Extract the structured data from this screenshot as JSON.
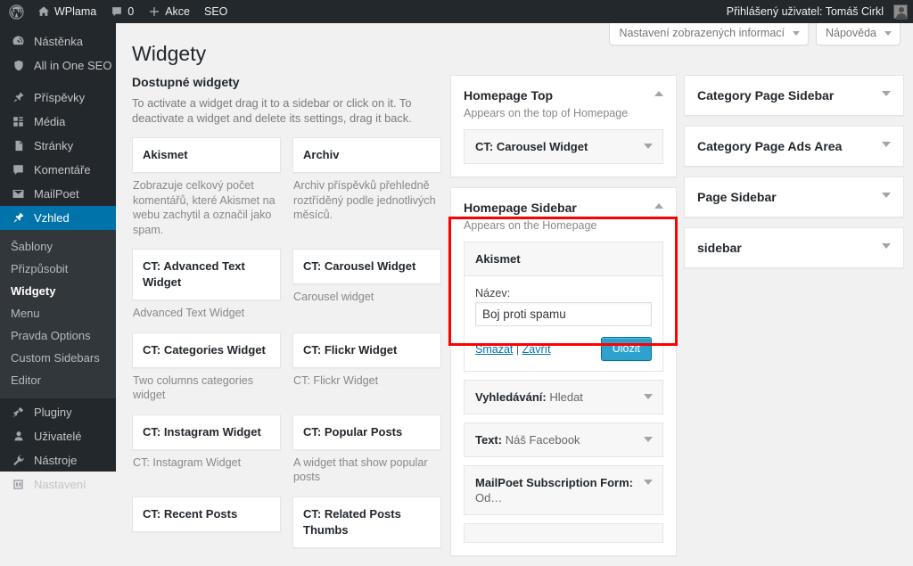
{
  "adminbar": {
    "logo_icon": "wordpress-logo-icon",
    "site_icon": "home-icon",
    "site_name": "WPlama",
    "comments_icon": "comment-bubble-icon",
    "comments_count": "0",
    "new_icon": "plus-icon",
    "new_label": "Akce",
    "seo_label": "SEO",
    "user_label": "Přihlášený uživatel: Tomáš Cirkl",
    "avatar": "user-avatar"
  },
  "adminmenu": {
    "items": [
      {
        "label": "Nástěnka",
        "icon": "dashboard-icon",
        "current": false
      },
      {
        "label": "All in One SEO",
        "icon": "shield-icon",
        "current": false
      },
      {
        "label": "Příspěvky",
        "icon": "pin-icon",
        "current": false
      },
      {
        "label": "Média",
        "icon": "media-icon",
        "current": false
      },
      {
        "label": "Stránky",
        "icon": "pages-icon",
        "current": false
      },
      {
        "label": "Komentáře",
        "icon": "comment-bubble-icon",
        "current": false
      },
      {
        "label": "MailPoet",
        "icon": "envelope-icon",
        "current": false
      },
      {
        "label": "Vzhled",
        "icon": "appearance-brush-icon",
        "current": true
      },
      {
        "label": "Pluginy",
        "icon": "plugin-plug-icon",
        "current": false
      },
      {
        "label": "Uživatelé",
        "icon": "user-icon",
        "current": false
      },
      {
        "label": "Nástroje",
        "icon": "wrench-icon",
        "current": false
      },
      {
        "label": "Nastavení",
        "icon": "settings-sliders-icon",
        "current": false
      }
    ],
    "submenu": [
      {
        "label": "Šablony",
        "current": false
      },
      {
        "label": "Přizpůsobit",
        "current": false
      },
      {
        "label": "Widgety",
        "current": true
      },
      {
        "label": "Menu",
        "current": false
      },
      {
        "label": "Pravda Options",
        "current": false
      },
      {
        "label": "Custom Sidebars",
        "current": false
      },
      {
        "label": "Editor",
        "current": false
      }
    ]
  },
  "screen_meta": {
    "screen_options_label": "Nastavení zobrazených informací",
    "help_label": "Nápověda"
  },
  "page": {
    "title": "Widgety",
    "available_heading": "Dostupné widgety",
    "available_description": "To activate a widget drag it to a sidebar or click on it. To deactivate a widget and delete its settings, drag it back."
  },
  "available_widgets": [
    {
      "name": "Akismet",
      "description": "Zobrazuje celkový počet komentářů, které Akismet na webu zachytil a označil jako spam."
    },
    {
      "name": "Archiv",
      "description": "Archiv příspěvků přehledně roztříděný podle jednotlivých měsíců."
    },
    {
      "name": "CT: Advanced Text Widget",
      "description": "Advanced Text Widget"
    },
    {
      "name": "CT: Carousel Widget",
      "description": "Carousel widget"
    },
    {
      "name": "CT: Categories Widget",
      "description": "Two columns categories widget"
    },
    {
      "name": "CT: Flickr Widget",
      "description": "CT: Flickr Widget"
    },
    {
      "name": "CT: Instagram Widget",
      "description": "CT: Instagram Widget"
    },
    {
      "name": "CT: Popular Posts",
      "description": "A widget that show popular posts"
    },
    {
      "name": "CT: Recent Posts",
      "description": ""
    },
    {
      "name": "CT: Related Posts Thumbs",
      "description": ""
    }
  ],
  "sidebars_mid": {
    "homepage_top": {
      "title": "Homepage Top",
      "description": "Appears on the top of Homepage",
      "toggle": "collapse-caret-up",
      "widgets": [
        {
          "title": "CT: Carousel Widget",
          "instance": "",
          "open": false
        }
      ]
    },
    "homepage_sidebar": {
      "title": "Homepage Sidebar",
      "description": "Appears on the Homepage",
      "toggle": "collapse-caret-up",
      "open_widget": {
        "title": "Akismet",
        "field_label": "Název:",
        "field_value": "Boj proti spamu",
        "field_placeholder": "",
        "delete_label": "Smazat",
        "separator": "|",
        "close_label": "Zavřít",
        "save_label": "Uložit",
        "save_color": "#2ea2cc"
      },
      "widgets": [
        {
          "title": "Vyhledávání:",
          "instance": "Hledat",
          "open": false
        },
        {
          "title": "Text:",
          "instance": "Náš Facebook",
          "open": false
        },
        {
          "title": "MailPoet Subscription Form:",
          "instance": "Od…",
          "open": false
        },
        {
          "title": "",
          "instance": "",
          "open": false
        }
      ]
    }
  },
  "sidebars_right": [
    {
      "title": "Category Page Sidebar",
      "toggle": "expand-caret-down"
    },
    {
      "title": "Category Page Ads Area",
      "toggle": "expand-caret-down"
    },
    {
      "title": "Page Sidebar",
      "toggle": "expand-caret-down"
    },
    {
      "title": "sidebar",
      "toggle": "expand-caret-down"
    }
  ],
  "annotation": {
    "highlight_color": "#fe0000"
  }
}
